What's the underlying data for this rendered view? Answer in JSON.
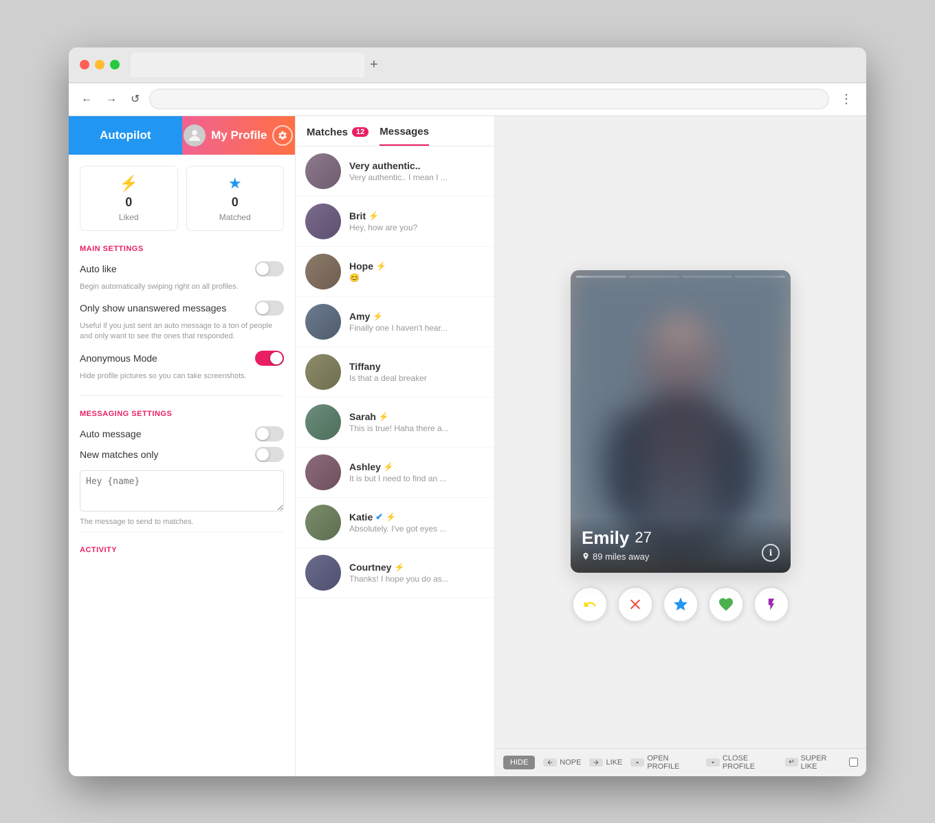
{
  "browser": {
    "tab_label": "",
    "address": "",
    "tab_plus": "+"
  },
  "nav": {
    "back": "←",
    "forward": "→",
    "refresh": "↺",
    "menu": "⋮"
  },
  "top_nav": {
    "autopilot_label": "Autopilot",
    "profile_label": "My Profile"
  },
  "stats": {
    "liked_icon": "⚡",
    "liked_count": "0",
    "liked_label": "Liked",
    "matched_icon": "★",
    "matched_count": "0",
    "matched_label": "Matched"
  },
  "main_settings": {
    "section_title": "MAIN SETTINGS",
    "auto_like_label": "Auto like",
    "auto_like_on": false,
    "auto_like_desc": "Begin automatically swiping right on all profiles.",
    "unanswered_label": "Only show unanswered messages",
    "unanswered_on": false,
    "unanswered_desc": "Useful if you just sent an auto message to a ton of people and only want to see the ones that responded.",
    "anonymous_label": "Anonymous Mode",
    "anonymous_on": true,
    "anonymous_desc": "Hide profile pictures so you can take screenshots."
  },
  "messaging_settings": {
    "section_title": "MESSAGING SETTINGS",
    "auto_message_label": "Auto message",
    "auto_message_on": false,
    "new_matches_label": "New matches only",
    "new_matches_on": false,
    "template_placeholder": "Hey {name}",
    "template_desc": "The message to send to matches."
  },
  "activity": {
    "section_title": "ACTIVITY"
  },
  "tabs": {
    "matches_label": "Matches",
    "matches_count": "12",
    "messages_label": "Messages"
  },
  "conversations": [
    {
      "name": "Very authentic..",
      "message": "Very authentic.. I mean I ...",
      "avatar_class": "avatar-top",
      "has_lightning": false,
      "verified": false
    },
    {
      "name": "Brit",
      "message": "Hey, how are you?",
      "avatar_class": "avatar-brit",
      "has_lightning": true,
      "verified": false
    },
    {
      "name": "Hope",
      "message": "😊",
      "avatar_class": "avatar-hope",
      "has_lightning": true,
      "verified": false
    },
    {
      "name": "Amy",
      "message": "Finally one I haven't hear...",
      "avatar_class": "avatar-amy",
      "has_lightning": true,
      "verified": false
    },
    {
      "name": "Tiffany",
      "message": "Is that a deal breaker",
      "avatar_class": "avatar-tiffany",
      "has_lightning": false,
      "verified": false
    },
    {
      "name": "Sarah",
      "message": "This is true! Haha there a...",
      "avatar_class": "avatar-sarah",
      "has_lightning": true,
      "verified": false
    },
    {
      "name": "Ashley",
      "message": "It is but I need to find an ...",
      "avatar_class": "avatar-ashley",
      "has_lightning": true,
      "verified": false
    },
    {
      "name": "Katie",
      "message": "Absolutely. I've got eyes ...",
      "avatar_class": "avatar-katie",
      "has_lightning": true,
      "verified": true
    },
    {
      "name": "Courtney",
      "message": "Thanks! I hope you do as...",
      "avatar_class": "avatar-courtney",
      "has_lightning": true,
      "verified": false
    }
  ],
  "profile_card": {
    "name": "Emily",
    "age": "27",
    "distance": "89 miles away",
    "info_icon": "ℹ"
  },
  "action_buttons": {
    "undo_icon": "↩",
    "nope_icon": "✕",
    "superlike_icon": "★",
    "like_icon": "♥",
    "boost_icon": "⚡"
  },
  "shortcuts": {
    "hide_label": "HIDE",
    "nope_label": "NOPE",
    "like_label": "LIKE",
    "open_profile_label": "OPEN PROFILE",
    "close_profile_label": "CLOSE PROFILE",
    "superlike_label": "SUPER LIKE"
  }
}
